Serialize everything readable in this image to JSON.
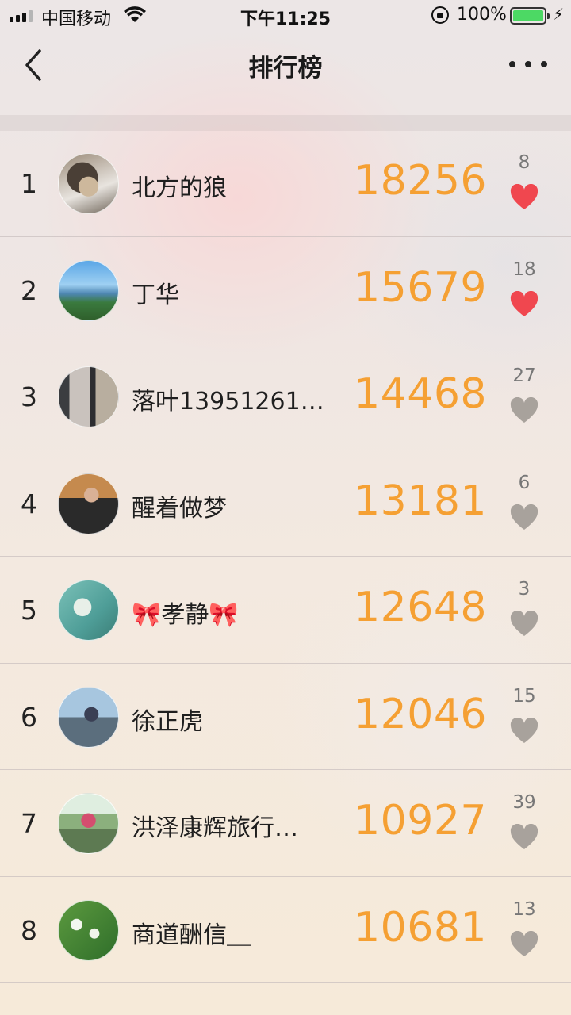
{
  "status_bar": {
    "carrier": "中国移动",
    "time": "下午11:25",
    "battery_percent": "100%",
    "battery_level": 1.0,
    "icons": [
      "signal-icon",
      "wifi-icon",
      "orientation-lock-icon",
      "battery-icon",
      "charging-icon"
    ]
  },
  "nav": {
    "title": "排行榜",
    "back_icon": "chevron-left-icon",
    "more_icon": "more-dots-icon"
  },
  "colors": {
    "score": "#f5a033",
    "heart_active": "#f0474f",
    "heart_inactive": "#a8a29c",
    "battery_green": "#4cd964"
  },
  "rankings": [
    {
      "rank": "1",
      "name": "北方的狼",
      "score": "18256",
      "likes": "8",
      "liked": true
    },
    {
      "rank": "2",
      "name": "丁华",
      "score": "15679",
      "likes": "18",
      "liked": true
    },
    {
      "rank": "3",
      "name": "落叶13951261…",
      "score": "14468",
      "likes": "27",
      "liked": false
    },
    {
      "rank": "4",
      "name": "醒着做梦",
      "score": "13181",
      "likes": "6",
      "liked": false
    },
    {
      "rank": "5",
      "name": "🎀孝静🎀",
      "score": "12648",
      "likes": "3",
      "liked": false
    },
    {
      "rank": "6",
      "name": "徐正虎",
      "score": "12046",
      "likes": "15",
      "liked": false
    },
    {
      "rank": "7",
      "name": "洪泽康辉旅行…",
      "score": "10927",
      "likes": "39",
      "liked": false
    },
    {
      "rank": "8",
      "name": "商道酬信＿",
      "score": "10681",
      "likes": "13",
      "liked": false
    }
  ]
}
